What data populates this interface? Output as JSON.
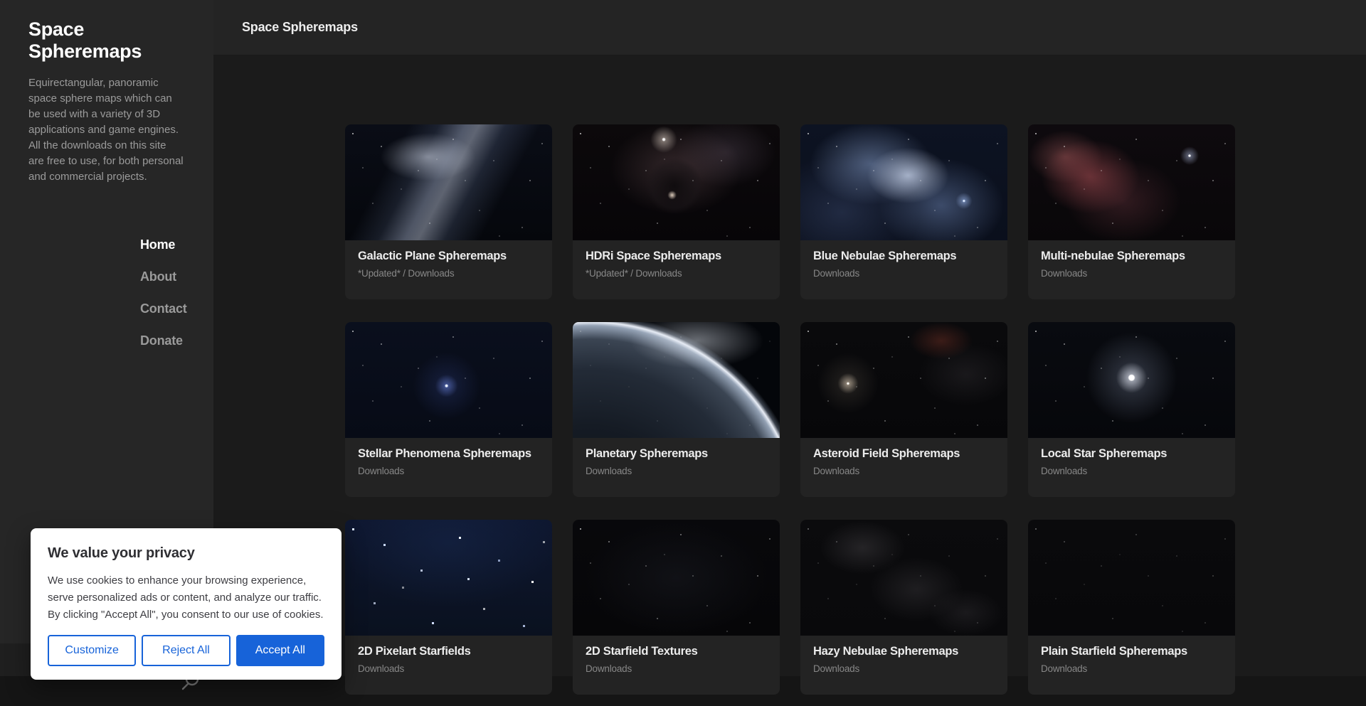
{
  "sidebar": {
    "title": "Space Spheremaps",
    "tagline": "Equirectangular, panoramic space sphere maps which can be used with a variety of 3D applications and game engines. All the downloads on this site are free to use, for both personal and commercial projects.",
    "nav": [
      {
        "label": "Home",
        "active": true
      },
      {
        "label": "About",
        "active": false
      },
      {
        "label": "Contact",
        "active": false
      },
      {
        "label": "Donate",
        "active": false
      }
    ]
  },
  "topbar": {
    "title": "Space Spheremaps"
  },
  "cards": [
    {
      "id": "galactic-plane",
      "title": "Galactic Plane Spheremaps",
      "subtitle": "*Updated* / Downloads"
    },
    {
      "id": "hdri-space",
      "title": "HDRi Space Spheremaps",
      "subtitle": "*Updated* / Downloads"
    },
    {
      "id": "blue-nebulae",
      "title": "Blue Nebulae Spheremaps",
      "subtitle": "Downloads"
    },
    {
      "id": "multi-nebulae",
      "title": "Multi-nebulae Spheremaps",
      "subtitle": "Downloads"
    },
    {
      "id": "stellar-phenomena",
      "title": "Stellar Phenomena Spheremaps",
      "subtitle": "Downloads"
    },
    {
      "id": "planetary",
      "title": "Planetary Spheremaps",
      "subtitle": "Downloads"
    },
    {
      "id": "asteroid-field",
      "title": "Asteroid Field Spheremaps",
      "subtitle": "Downloads"
    },
    {
      "id": "local-star",
      "title": "Local Star Spheremaps",
      "subtitle": "Downloads"
    },
    {
      "id": "pixelart-starfields",
      "title": "2D Pixelart Starfields",
      "subtitle": "Downloads"
    },
    {
      "id": "starfield-textures",
      "title": "2D Starfield Textures",
      "subtitle": "Downloads"
    },
    {
      "id": "hazy-nebulae",
      "title": "Hazy Nebulae Spheremaps",
      "subtitle": "Downloads"
    },
    {
      "id": "plain-starfield",
      "title": "Plain Starfield Spheremaps",
      "subtitle": "Downloads"
    }
  ],
  "search": {
    "icon": "search-icon"
  },
  "cookie_dialog": {
    "title": "We value your privacy",
    "body": "We use cookies to enhance your browsing experience, serve personalized ads or content, and analyze our traffic. By clicking \"Accept All\", you consent to our use of cookies.",
    "buttons": [
      {
        "label": "Customize",
        "style": "outline"
      },
      {
        "label": "Reject All",
        "style": "outline"
      },
      {
        "label": "Accept All",
        "style": "filled"
      }
    ]
  },
  "colors": {
    "accent_blue": "#1763d9",
    "sidebar_bg": "#262626",
    "page_bg": "#1b1b1b",
    "card_bg": "#232323"
  }
}
